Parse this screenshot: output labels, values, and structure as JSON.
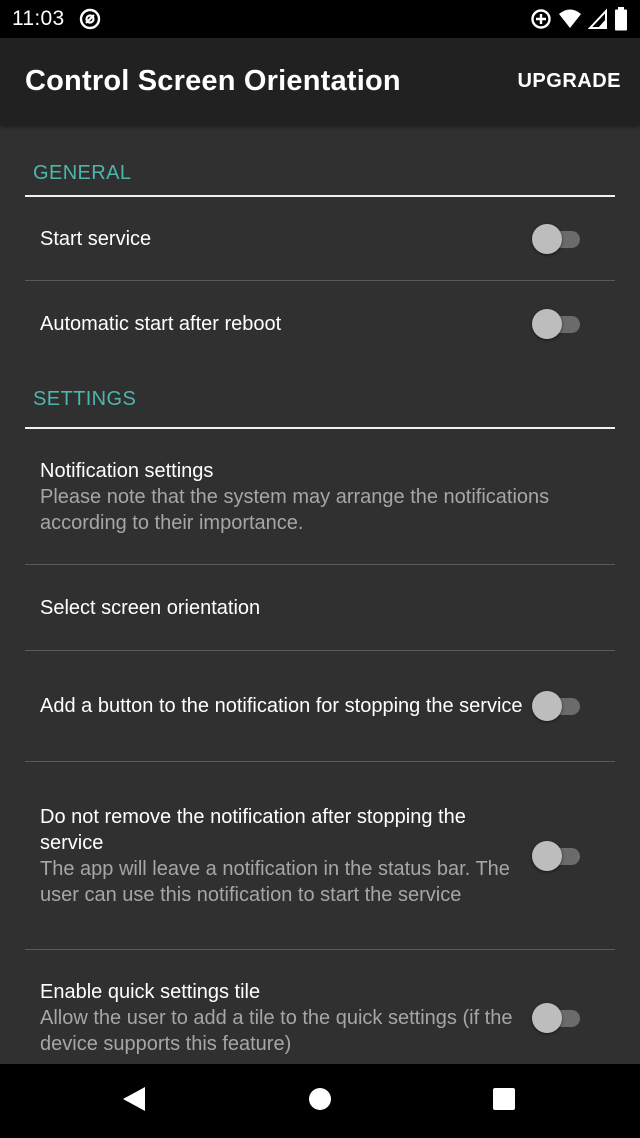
{
  "status_bar": {
    "time": "11:03",
    "icons": [
      "at-sign-icon",
      "data-saver-icon",
      "wifi-icon",
      "signal-icon",
      "battery-icon"
    ]
  },
  "app_bar": {
    "title": "Control Screen Orientation",
    "upgrade_label": "UPGRADE"
  },
  "colors": {
    "accent": "#4db6ac",
    "background": "#303030",
    "app_bar": "#212121"
  },
  "sections": {
    "general": {
      "header": "GENERAL",
      "start_service": {
        "title": "Start service",
        "checked": false
      },
      "auto_start": {
        "title": "Automatic start after reboot",
        "checked": false
      }
    },
    "settings": {
      "header": "SETTINGS",
      "notification_settings": {
        "title": "Notification settings",
        "summary": "Please note that the system may arrange the notifications according to their importance."
      },
      "select_orientation": {
        "title": "Select screen orientation"
      },
      "stop_button": {
        "title": "Add a button to the notification for stopping the service",
        "checked": false
      },
      "keep_notification": {
        "title": "Do not remove the notification after stopping the service",
        "summary": "The app will leave a notification in the status bar. The user can use this notification to start the service",
        "checked": false
      },
      "quick_tile": {
        "title": "Enable quick settings tile",
        "summary": "Allow the user to add a tile to the quick settings (if the device supports this feature)",
        "checked": false
      }
    }
  },
  "nav_bar": {
    "icons": [
      "back-icon",
      "home-icon",
      "recents-icon"
    ]
  }
}
